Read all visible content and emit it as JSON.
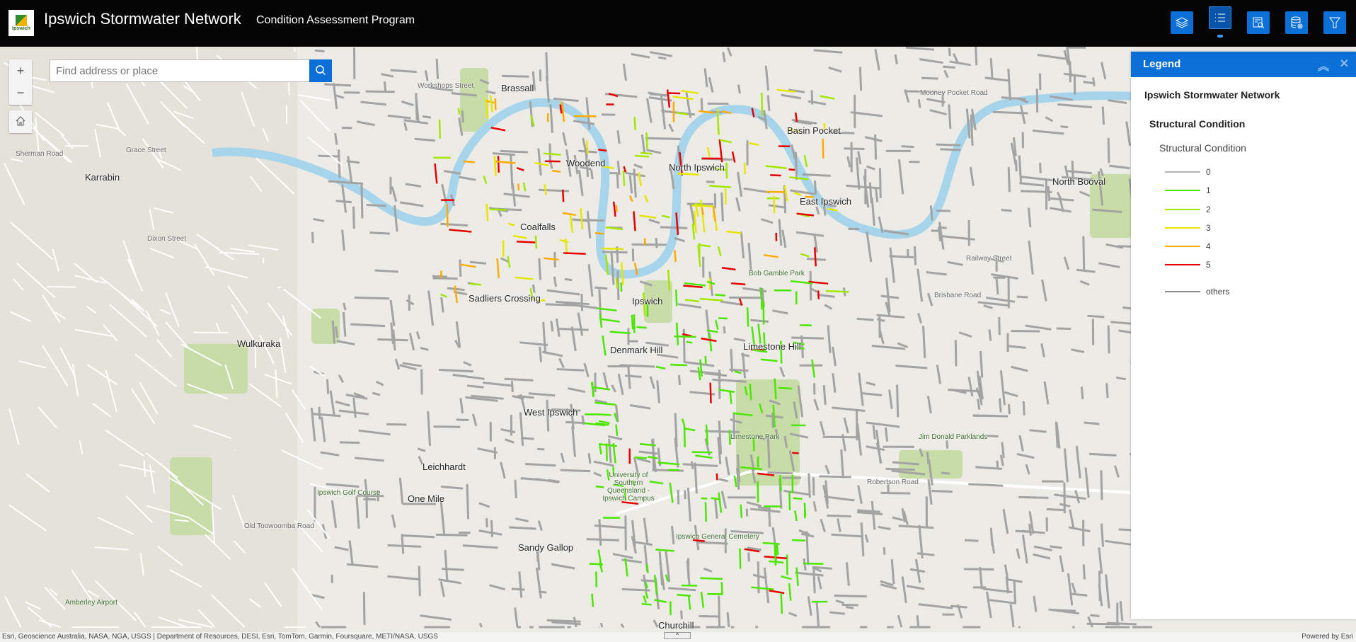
{
  "header": {
    "logo_text": "Ipswich",
    "title": "Ipswich Stormwater Network",
    "subtitle": "Condition Assessment Program",
    "tools": [
      {
        "name": "layers-icon"
      },
      {
        "name": "legend-icon",
        "active": true
      },
      {
        "name": "query-icon"
      },
      {
        "name": "add-data-icon"
      },
      {
        "name": "filter-icon"
      }
    ]
  },
  "map": {
    "zoom_in": "+",
    "zoom_out": "−",
    "search_placeholder": "Find address or place",
    "places": [
      {
        "t": "Brassall",
        "c": "big"
      },
      {
        "t": "Woodend",
        "c": "big"
      },
      {
        "t": "Coalfalls",
        "c": "big"
      },
      {
        "t": "North Ipswich",
        "c": "big"
      },
      {
        "t": "Basin Pocket",
        "c": "big"
      },
      {
        "t": "East Ipswich",
        "c": "big"
      },
      {
        "t": "North Booval",
        "c": "big"
      },
      {
        "t": "Karrabin",
        "c": "big"
      },
      {
        "t": "Wulkuraka",
        "c": "big"
      },
      {
        "t": "Sadliers Crossing",
        "c": "big"
      },
      {
        "t": "Ipswich",
        "c": "big"
      },
      {
        "t": "Denmark Hill",
        "c": "big"
      },
      {
        "t": "Limestone Hill",
        "c": "big"
      },
      {
        "t": "West Ipswich",
        "c": "big"
      },
      {
        "t": "Leichhardt",
        "c": "big"
      },
      {
        "t": "One Mile",
        "c": "big"
      },
      {
        "t": "Sandy Gallop",
        "c": "big"
      },
      {
        "t": "Churchill",
        "c": "big"
      },
      {
        "t": "Ipswich Golf Course",
        "c": "park"
      },
      {
        "t": "University of Southern Queensland - Ipswich Campus",
        "c": "park"
      },
      {
        "t": "Limestone Park",
        "c": "park"
      },
      {
        "t": "Ipswich General Cemetery",
        "c": "park"
      },
      {
        "t": "Bob Gamble Park",
        "c": "park"
      },
      {
        "t": "Jim Donald Parklands",
        "c": "park"
      },
      {
        "t": "Amberley Airport",
        "c": "park"
      },
      {
        "t": "Brisbane Road",
        "c": "street"
      },
      {
        "t": "Workshops Street",
        "c": "street"
      },
      {
        "t": "Sherman Road",
        "c": "street"
      },
      {
        "t": "Grace Street",
        "c": "street"
      },
      {
        "t": "Dixon Street",
        "c": "street"
      },
      {
        "t": "Old Toowoomba Road",
        "c": "street"
      },
      {
        "t": "Robertson Road",
        "c": "street"
      },
      {
        "t": "Railway Street",
        "c": "street"
      },
      {
        "t": "Mooney Pocket Road",
        "c": "street"
      }
    ]
  },
  "legend": {
    "title": "Legend",
    "layer": "Ipswich Stormwater Network",
    "group": "Structural Condition",
    "field": "Structural Condition",
    "items": [
      {
        "label": "0",
        "color": "#b4b4b4"
      },
      {
        "label": "1",
        "color": "#4ce600"
      },
      {
        "label": "2",
        "color": "#a3e600"
      },
      {
        "label": "3",
        "color": "#e6e600"
      },
      {
        "label": "4",
        "color": "#ffaa00"
      },
      {
        "label": "5",
        "color": "#e60000"
      },
      {
        "label": "others",
        "color": "#8c8c8c"
      }
    ]
  },
  "attribution": {
    "text": "Esri, Geoscience Australia, NASA, NGA, USGS | Department of Resources, DESI, Esri, TomTom, Garmin, Foursquare, METI/NASA, USGS",
    "powered": "Powered by Esri"
  }
}
